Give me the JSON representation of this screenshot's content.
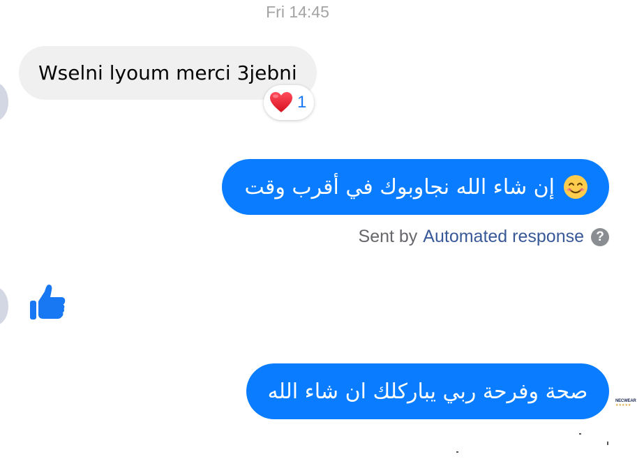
{
  "timestamp": "Fri 14:45",
  "incoming_message": {
    "text": "Wselni lyoum merci 3jebni",
    "reaction": {
      "icon": "heart-icon",
      "count": "1"
    }
  },
  "outgoing_messages": [
    {
      "text": "إن شاء الله نجاوبوك في أقرب وقت",
      "emoji": "smiling-face-icon"
    },
    {
      "text": "صحة وفرحة ربي يباركلك ان شاء الله"
    }
  ],
  "automated_note": {
    "prefix": "Sent by",
    "link": "Automated response",
    "help_icon": "?"
  },
  "like_sticker": {
    "icon": "thumbs-up-icon"
  },
  "seen_avatar": {
    "text": "NECWEAR",
    "stars": "★★★★★"
  },
  "colors": {
    "outgoing_bubble": "#0a7cff",
    "incoming_bubble": "#f0f0f0",
    "accent_blue": "#1877f2",
    "like_blue": "#1877f2"
  }
}
